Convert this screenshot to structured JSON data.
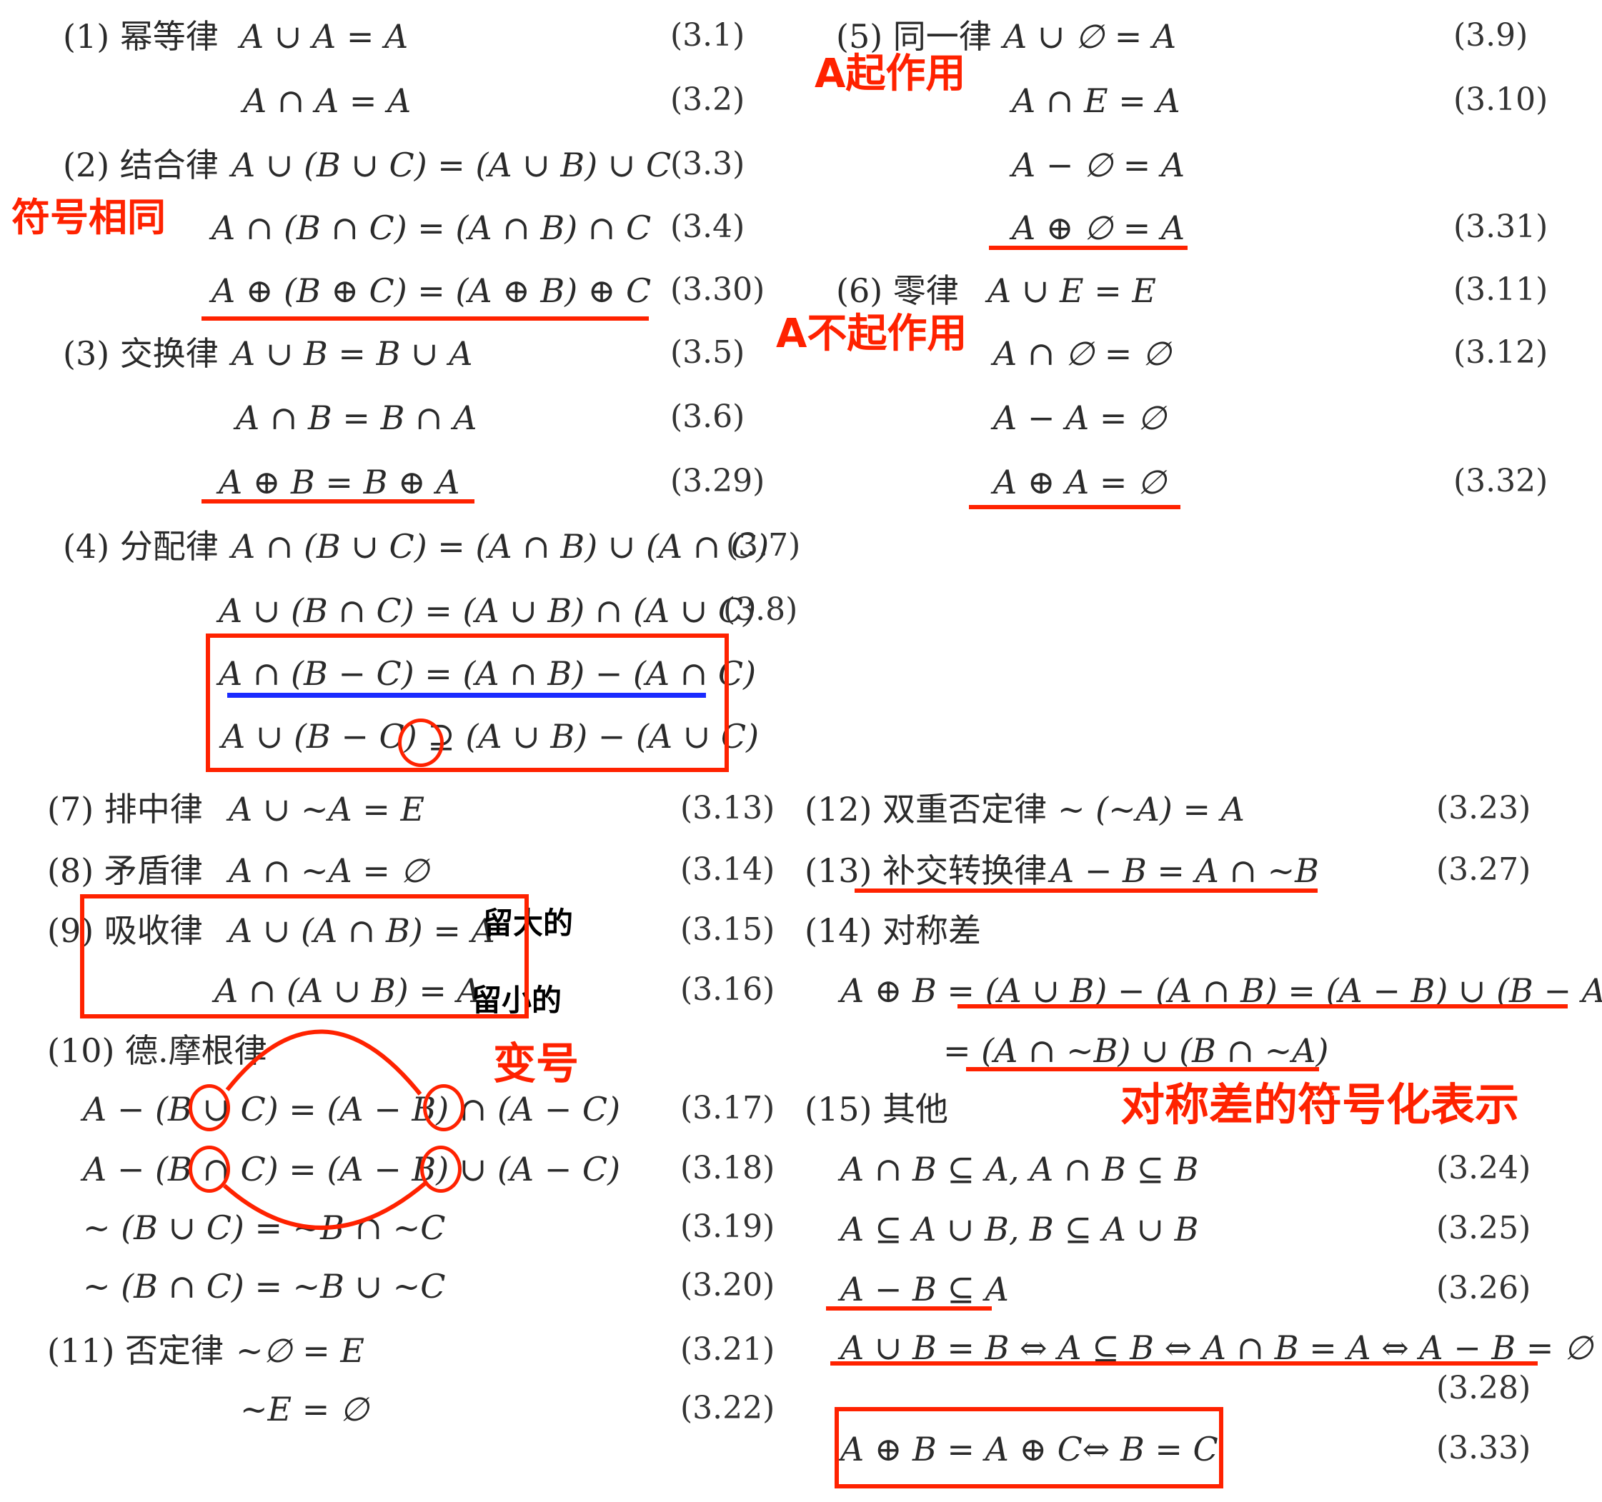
{
  "laws": {
    "l1": {
      "label": "(1) 幂等律",
      "f1": "A ∪ A = A",
      "n1": "(3.1)",
      "f2": "A ∩ A = A",
      "n2": "(3.2)"
    },
    "l2": {
      "label": "(2) 结合律",
      "f1": "A ∪ (B ∪ C) = (A ∪ B) ∪ C",
      "n1": "(3.3)",
      "f2": "A ∩ (B ∩ C) = (A ∩ B) ∩ C",
      "n2": "(3.4)",
      "f3": "A ⊕ (B ⊕ C) = (A ⊕ B) ⊕ C",
      "n3": "(3.30)"
    },
    "l3": {
      "label": "(3) 交换律",
      "f1": "A ∪ B = B ∪ A",
      "n1": "(3.5)",
      "f2": "A ∩ B = B ∩ A",
      "n2": "(3.6)",
      "f3": "A ⊕ B = B ⊕ A",
      "n3": "(3.29)"
    },
    "l4": {
      "label": "(4) 分配律",
      "f1": "A ∩ (B ∪ C) = (A ∩ B) ∪ (A ∩ C)",
      "n1": "(3.7)",
      "f2": "A ∪ (B ∩ C) = (A ∪ B) ∩ (A ∪ C)",
      "n2": "(3.8)",
      "f3": "A ∩ (B − C) = (A ∩ B) − (A ∩ C)",
      "f4": "A ∪ (B − C) ⊇ (A ∪ B) − (A ∪ C)"
    },
    "l5": {
      "label": "(5) 同一律",
      "f1": "A ∪ ∅ = A",
      "n1": "(3.9)",
      "f2": "A ∩ E = A",
      "n2": "(3.10)",
      "f3": "A − ∅ = A",
      "f4": "A ⊕ ∅ = A",
      "n4": "(3.31)"
    },
    "l6": {
      "label": "(6) 零律",
      "f1": "A ∪ E = E",
      "n1": "(3.11)",
      "f2": "A ∩ ∅ = ∅",
      "n2": "(3.12)",
      "f3": "A − A = ∅",
      "f4": "A ⊕ A = ∅",
      "n4": "(3.32)"
    },
    "l7": {
      "label": "(7)  排中律",
      "f1": "A ∪ ~A = E",
      "n1": "(3.13)"
    },
    "l8": {
      "label": "(8)  矛盾律",
      "f1": "A ∩ ~A = ∅",
      "n1": "(3.14)"
    },
    "l9": {
      "label": "(9)  吸收律",
      "f1": "A ∪  (A ∩ B)  = A",
      "n1": "(3.15)",
      "f2": "A ∩  (A ∪ B)  = A",
      "n2": "(3.16)"
    },
    "l10": {
      "label": "(10)  德.摩根律",
      "f1": "A −  (B ∪ C) =  (A − B) ∩ (A − C)",
      "n1": "(3.17)",
      "f2": "A −  (B ∩ C) =  (A − B) ∪ (A − C)",
      "n2": "(3.18)",
      "f3": "~ (B ∪ C) = ~B ∩ ~C",
      "n3": "(3.19)",
      "f4": "~ (B ∩ C) = ~B ∪ ~C",
      "n4": "(3.20)"
    },
    "l11": {
      "label": "(11) 否定律",
      "f1": "~∅ = E",
      "n1": "(3.21)",
      "f2": "~E = ∅",
      "n2": "(3.22)"
    },
    "l12": {
      "label": "(12) 双重否定律",
      "f1": "~ (~A) = A",
      "n1": "(3.23)"
    },
    "l13": {
      "label": "(13) 补交转换律",
      "f1": "A − B = A ∩ ~B",
      "n1": "(3.27)"
    },
    "l14": {
      "label": "(14) 对称差",
      "f1": "A ⊕ B = (A ∪ B) − (A ∩ B) =  (A − B) ∪ (B − A)",
      "f2": "=  (A ∩ ~B) ∪  (B ∩ ~A)"
    },
    "l15": {
      "label": "(15) 其他",
      "f1": "A ∩ B ⊆ A, A ∩ B ⊆ B",
      "n1": "(3.24)",
      "f2": "A ⊆ A ∪ B, B ⊆ A ∪ B",
      "n2": "(3.25)",
      "f3": "A − B ⊆ A",
      "n3": "(3.26)",
      "f4": "A ∪ B = B ⇔ A ⊆ B ⇔ A ∩ B = A ⇔ A − B = ∅",
      "n4": "(3.28)",
      "f5": "A ⊕ B = A ⊕ C⇔ B = C",
      "n5": "(3.33)"
    }
  },
  "notes": {
    "same_symbol": "符号相同",
    "a_acts": "A起作用",
    "a_not_act": "A不起作用",
    "keep_big": "留大的",
    "keep_small": "留小的",
    "change_sign": "变号",
    "sym_diff": "对称差的符号化表示"
  },
  "colors": {
    "annotation": "#ff2200",
    "underline_blue": "#1a2bff",
    "text": "#2a2a2a"
  }
}
